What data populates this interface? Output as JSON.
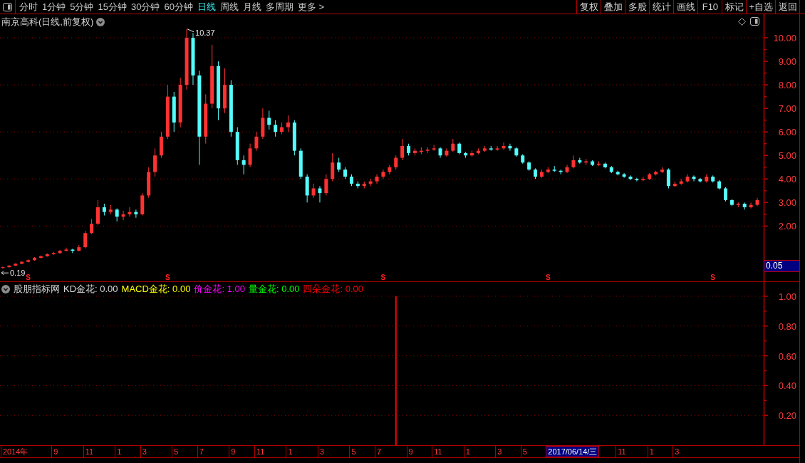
{
  "toolbar": {
    "periods": [
      {
        "label": "分时",
        "selected": false
      },
      {
        "label": "1分钟",
        "selected": false
      },
      {
        "label": "5分钟",
        "selected": false
      },
      {
        "label": "15分钟",
        "selected": false
      },
      {
        "label": "30分钟",
        "selected": false
      },
      {
        "label": "60分钟",
        "selected": false
      },
      {
        "label": "日线",
        "selected": true
      },
      {
        "label": "周线",
        "selected": false
      },
      {
        "label": "月线",
        "selected": false
      },
      {
        "label": "多周期",
        "selected": false
      },
      {
        "label": "更多 >",
        "selected": false
      }
    ],
    "buttons": [
      "复权",
      "叠加",
      "多股",
      "统计",
      "画线",
      "F10",
      "标记",
      "+自选",
      "返回"
    ]
  },
  "main_chart": {
    "title": "南京高科(日线,前复权)",
    "chart_data": [
      {
        "type": "candlestick",
        "ylim": [
          -0.35,
          11
        ],
        "yticks": [
          {
            "value": 2,
            "label": "2.00"
          },
          {
            "value": 3,
            "label": "3.00"
          },
          {
            "value": 4,
            "label": "4.00"
          },
          {
            "value": 5,
            "label": "5.00"
          },
          {
            "value": 6,
            "label": "6.00"
          },
          {
            "value": 7,
            "label": "7.00"
          },
          {
            "value": 8,
            "label": "8.00"
          },
          {
            "value": 9,
            "label": "9.00"
          },
          {
            "value": 10,
            "label": "10.00"
          }
        ],
        "grid": true,
        "ohlc": [
          [
            0.22,
            0.28,
            0.19,
            0.25
          ],
          [
            0.25,
            0.34,
            0.24,
            0.32
          ],
          [
            0.32,
            0.42,
            0.3,
            0.4
          ],
          [
            0.4,
            0.5,
            0.38,
            0.48
          ],
          [
            0.48,
            0.58,
            0.45,
            0.55
          ],
          [
            0.55,
            0.68,
            0.53,
            0.65
          ],
          [
            0.65,
            0.75,
            0.62,
            0.72
          ],
          [
            0.72,
            0.84,
            0.7,
            0.8
          ],
          [
            0.8,
            0.9,
            0.78,
            0.85
          ],
          [
            0.85,
            0.99,
            0.83,
            0.95
          ],
          [
            0.95,
            1.08,
            0.92,
            1.0
          ],
          [
            1.0,
            1.04,
            0.85,
            0.95
          ],
          [
            0.95,
            1.2,
            0.93,
            1.1
          ],
          [
            1.1,
            1.8,
            1.05,
            1.7
          ],
          [
            1.7,
            2.3,
            1.65,
            2.1
          ],
          [
            2.1,
            3.1,
            2.05,
            2.8
          ],
          [
            2.8,
            2.95,
            2.45,
            2.6
          ],
          [
            2.6,
            2.9,
            2.5,
            2.7
          ],
          [
            2.7,
            2.75,
            2.2,
            2.4
          ],
          [
            2.4,
            2.65,
            2.25,
            2.5
          ],
          [
            2.5,
            2.8,
            2.4,
            2.6
          ],
          [
            2.6,
            2.7,
            2.35,
            2.5
          ],
          [
            2.5,
            3.4,
            2.45,
            3.3
          ],
          [
            3.3,
            4.5,
            3.2,
            4.3
          ],
          [
            4.3,
            5.3,
            4.1,
            5.0
          ],
          [
            5.0,
            6.0,
            4.9,
            5.8
          ],
          [
            5.8,
            8.0,
            5.7,
            7.5
          ],
          [
            7.5,
            7.7,
            6.0,
            6.4
          ],
          [
            6.4,
            8.3,
            6.2,
            8.0
          ],
          [
            8.0,
            10.37,
            7.8,
            10.0
          ],
          [
            10.0,
            10.2,
            8.0,
            8.4
          ],
          [
            8.4,
            8.6,
            4.6,
            5.8
          ],
          [
            5.8,
            7.6,
            5.5,
            7.2
          ],
          [
            7.2,
            9.7,
            7.0,
            8.8
          ],
          [
            8.8,
            9.0,
            6.5,
            7.0
          ],
          [
            7.0,
            8.7,
            6.8,
            8.0
          ],
          [
            8.0,
            8.2,
            5.8,
            6.0
          ],
          [
            6.0,
            6.2,
            4.6,
            4.8
          ],
          [
            4.8,
            5.0,
            4.2,
            4.6
          ],
          [
            4.6,
            5.5,
            4.5,
            5.3
          ],
          [
            5.3,
            6.0,
            5.2,
            5.8
          ],
          [
            5.8,
            7.0,
            5.7,
            6.6
          ],
          [
            6.6,
            6.9,
            6.1,
            6.3
          ],
          [
            6.3,
            6.5,
            5.8,
            6.0
          ],
          [
            6.0,
            6.4,
            5.9,
            6.2
          ],
          [
            6.2,
            6.7,
            6.0,
            6.4
          ],
          [
            6.4,
            6.5,
            5.0,
            5.2
          ],
          [
            5.2,
            5.3,
            4.0,
            4.1
          ],
          [
            4.1,
            4.2,
            3.0,
            3.3
          ],
          [
            3.3,
            3.8,
            3.2,
            3.6
          ],
          [
            3.6,
            3.7,
            3.0,
            3.4
          ],
          [
            3.4,
            4.2,
            3.3,
            4.0
          ],
          [
            4.0,
            5.1,
            3.9,
            4.7
          ],
          [
            4.7,
            4.9,
            4.3,
            4.4
          ],
          [
            4.4,
            4.5,
            4.0,
            4.1
          ],
          [
            4.1,
            4.2,
            3.7,
            3.8
          ],
          [
            3.8,
            3.9,
            3.6,
            3.7
          ],
          [
            3.7,
            3.9,
            3.6,
            3.8
          ],
          [
            3.8,
            4.0,
            3.7,
            3.9
          ],
          [
            3.9,
            4.2,
            3.8,
            4.1
          ],
          [
            4.1,
            4.4,
            4.0,
            4.3
          ],
          [
            4.3,
            4.6,
            4.2,
            4.5
          ],
          [
            4.5,
            5.0,
            4.4,
            4.9
          ],
          [
            4.9,
            5.7,
            4.8,
            5.4
          ],
          [
            5.4,
            5.5,
            5.0,
            5.1
          ],
          [
            5.1,
            5.3,
            5.0,
            5.2
          ],
          [
            5.15,
            5.35,
            5.05,
            5.2
          ],
          [
            5.2,
            5.35,
            5.1,
            5.25
          ],
          [
            5.25,
            5.45,
            5.2,
            5.3
          ],
          [
            5.3,
            5.35,
            4.9,
            5.0
          ],
          [
            5.0,
            5.3,
            4.95,
            5.2
          ],
          [
            5.2,
            5.7,
            5.15,
            5.5
          ],
          [
            5.5,
            5.55,
            5.05,
            5.1
          ],
          [
            5.1,
            5.15,
            4.9,
            5.0
          ],
          [
            5.0,
            5.2,
            4.95,
            5.1
          ],
          [
            5.1,
            5.3,
            5.05,
            5.2
          ],
          [
            5.2,
            5.4,
            5.15,
            5.3
          ],
          [
            5.3,
            5.4,
            5.2,
            5.25
          ],
          [
            5.25,
            5.4,
            5.2,
            5.3
          ],
          [
            5.3,
            5.55,
            5.25,
            5.4
          ],
          [
            5.4,
            5.5,
            5.2,
            5.3
          ],
          [
            5.3,
            5.35,
            4.95,
            5.0
          ],
          [
            5.0,
            5.05,
            4.65,
            4.7
          ],
          [
            4.7,
            4.75,
            4.35,
            4.4
          ],
          [
            4.4,
            4.45,
            4.0,
            4.1
          ],
          [
            4.1,
            4.4,
            4.05,
            4.3
          ],
          [
            4.3,
            4.5,
            4.25,
            4.4
          ],
          [
            4.4,
            4.55,
            4.3,
            4.35
          ],
          [
            4.35,
            4.4,
            4.2,
            4.3
          ],
          [
            4.3,
            4.6,
            4.25,
            4.5
          ],
          [
            4.5,
            5.0,
            4.45,
            4.8
          ],
          [
            4.8,
            4.9,
            4.65,
            4.7
          ],
          [
            4.7,
            4.85,
            4.6,
            4.75
          ],
          [
            4.75,
            4.8,
            4.55,
            4.6
          ],
          [
            4.6,
            4.75,
            4.55,
            4.65
          ],
          [
            4.65,
            4.7,
            4.45,
            4.5
          ],
          [
            4.5,
            4.55,
            4.25,
            4.3
          ],
          [
            4.3,
            4.35,
            4.15,
            4.2
          ],
          [
            4.2,
            4.25,
            4.05,
            4.1
          ],
          [
            4.1,
            4.15,
            3.95,
            4.0
          ],
          [
            4.0,
            4.05,
            3.9,
            3.95
          ],
          [
            3.95,
            4.1,
            3.9,
            4.0
          ],
          [
            4.0,
            4.25,
            3.95,
            4.2
          ],
          [
            4.2,
            4.35,
            4.15,
            4.3
          ],
          [
            4.3,
            4.5,
            4.25,
            4.4
          ],
          [
            4.4,
            4.45,
            3.6,
            3.7
          ],
          [
            3.7,
            3.9,
            3.65,
            3.8
          ],
          [
            3.8,
            4.0,
            3.75,
            3.9
          ],
          [
            3.9,
            4.2,
            3.85,
            4.1
          ],
          [
            4.1,
            4.15,
            3.9,
            4.0
          ],
          [
            4.0,
            4.05,
            3.85,
            3.9
          ],
          [
            3.9,
            4.2,
            3.85,
            4.1
          ],
          [
            4.1,
            4.15,
            3.85,
            3.9
          ],
          [
            3.9,
            3.95,
            3.55,
            3.6
          ],
          [
            3.6,
            3.65,
            3.05,
            3.1
          ],
          [
            3.1,
            3.15,
            2.85,
            2.9
          ],
          [
            2.9,
            3.0,
            2.8,
            2.95
          ],
          [
            2.95,
            3.0,
            2.7,
            2.8
          ],
          [
            2.8,
            3.0,
            2.75,
            2.9
          ],
          [
            2.9,
            3.2,
            2.85,
            3.1
          ]
        ],
        "annotations": [
          "10.37",
          "0.19",
          "S",
          "S",
          "S",
          "S",
          "S"
        ]
      }
    ]
  },
  "indicator": {
    "name": "股朋指标网",
    "legend": [
      {
        "label": "KD金花: 0.00",
        "color": "#dcdcdc"
      },
      {
        "label": "MACD金花: 0.00",
        "color": "#ffff00"
      },
      {
        "label": "价金花: 1.00",
        "color": "#ff00ff"
      },
      {
        "label": "量金花: 0.00",
        "color": "#00ff00"
      },
      {
        "label": "四朵金花: 0.00",
        "color": "#ff0000"
      }
    ],
    "chart_data": [
      {
        "type": "bar",
        "color": "#ff0000",
        "ylim": [
          0,
          1.095
        ],
        "yticks": [
          {
            "value": 0.2,
            "label": "0.20"
          },
          {
            "value": 0.4,
            "label": "0.40"
          },
          {
            "value": 0.6,
            "label": "0.60"
          },
          {
            "value": 0.8,
            "label": "0.80"
          },
          {
            "value": 1,
            "label": "1.00"
          }
        ],
        "grid": true,
        "categories": [
          "2014年",
          null,
          null,
          null,
          null,
          null,
          null,
          null,
          "9",
          null,
          null,
          null,
          null,
          "11",
          null,
          null,
          null,
          null,
          "1",
          null,
          null,
          null,
          "3",
          null,
          null,
          null,
          null,
          "5",
          null,
          null,
          null,
          "7",
          null,
          null,
          null,
          null,
          "9",
          null,
          null,
          null,
          "11",
          null,
          null,
          null,
          null,
          "1",
          null,
          null,
          null,
          null,
          "3",
          null,
          null,
          null,
          null,
          "5",
          null,
          null,
          null,
          "7",
          null,
          null,
          null,
          null,
          "9",
          null,
          null,
          null,
          "11",
          null,
          null,
          null,
          null,
          "1",
          null,
          null,
          null,
          null,
          "3",
          null,
          null,
          null,
          "5",
          null,
          null,
          null,
          null,
          null,
          null,
          null,
          null,
          null,
          null,
          null,
          null,
          null,
          null,
          "11",
          null,
          null,
          null,
          null,
          "1",
          null,
          null,
          null,
          "3",
          null,
          null,
          null,
          null,
          null,
          null,
          null,
          null,
          null,
          null,
          null,
          null,
          null
        ],
        "values": [
          0,
          0,
          0,
          0,
          0,
          0,
          0,
          0,
          0,
          0,
          0,
          0,
          0,
          0,
          0,
          0,
          0,
          0,
          0,
          0,
          0,
          0,
          0,
          0,
          0,
          0,
          0,
          0,
          0,
          0,
          0,
          0,
          0,
          0,
          0,
          0,
          0,
          0,
          0,
          0,
          0,
          0,
          0,
          0,
          0,
          0,
          0,
          0,
          0,
          0,
          0,
          0,
          0,
          0,
          0,
          0,
          0,
          0,
          0,
          0,
          0,
          0,
          1,
          0,
          0,
          0,
          0,
          0,
          0,
          0,
          0,
          0,
          0,
          0,
          0,
          0,
          0,
          0,
          0,
          0,
          0,
          0,
          0,
          0,
          0,
          0,
          0,
          0,
          0,
          0,
          0,
          0,
          0,
          0,
          0,
          0,
          0,
          0,
          0,
          0,
          0,
          0,
          0,
          0,
          0,
          0,
          0,
          0,
          0,
          0,
          0,
          0,
          0,
          0,
          0,
          0,
          0,
          0,
          0,
          0
        ]
      }
    ]
  },
  "cursor": {
    "date_label": "2017/06/14/三",
    "price_label": "0.05"
  }
}
